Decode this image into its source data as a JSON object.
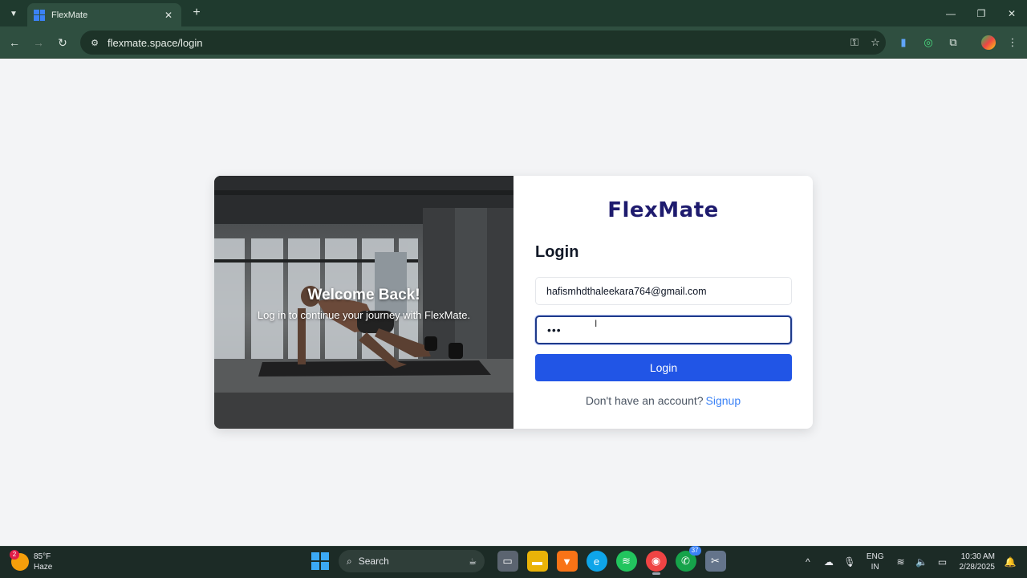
{
  "browser": {
    "tab_title": "FlexMate",
    "url": "flexmate.space/login",
    "icons": {
      "tab_search": "chevron-down-icon",
      "tab_close": "close-icon",
      "new_tab": "plus-icon",
      "back": "arrow-left-icon",
      "forward": "arrow-right-icon",
      "reload": "reload-icon",
      "site_info": "tune-icon",
      "password": "key-icon",
      "bookmark": "star-icon",
      "menu": "kebab-menu-icon"
    }
  },
  "page": {
    "hero": {
      "title": "Welcome Back!",
      "subtitle": "Log in to continue your journey with FlexMate."
    },
    "brand": "FlexMate",
    "form_title": "Login",
    "email_value": "hafismhdthaleekara764@gmail.com",
    "password_value": "•••",
    "login_label": "Login",
    "signup_prompt": "Don't have an account?",
    "signup_link": "Signup",
    "colors": {
      "primary": "#2155e6",
      "brand": "#1e1b6e",
      "link": "#3b82f6",
      "page_bg": "#f3f4f6"
    }
  },
  "taskbar": {
    "weather_temp": "85°F",
    "weather_desc": "Haze",
    "weather_badge": "2",
    "search_label": "Search",
    "whatsapp_badge": "37",
    "lang_line1": "ENG",
    "lang_line2": "IN",
    "time": "10:30 AM",
    "date": "2/28/2025"
  }
}
